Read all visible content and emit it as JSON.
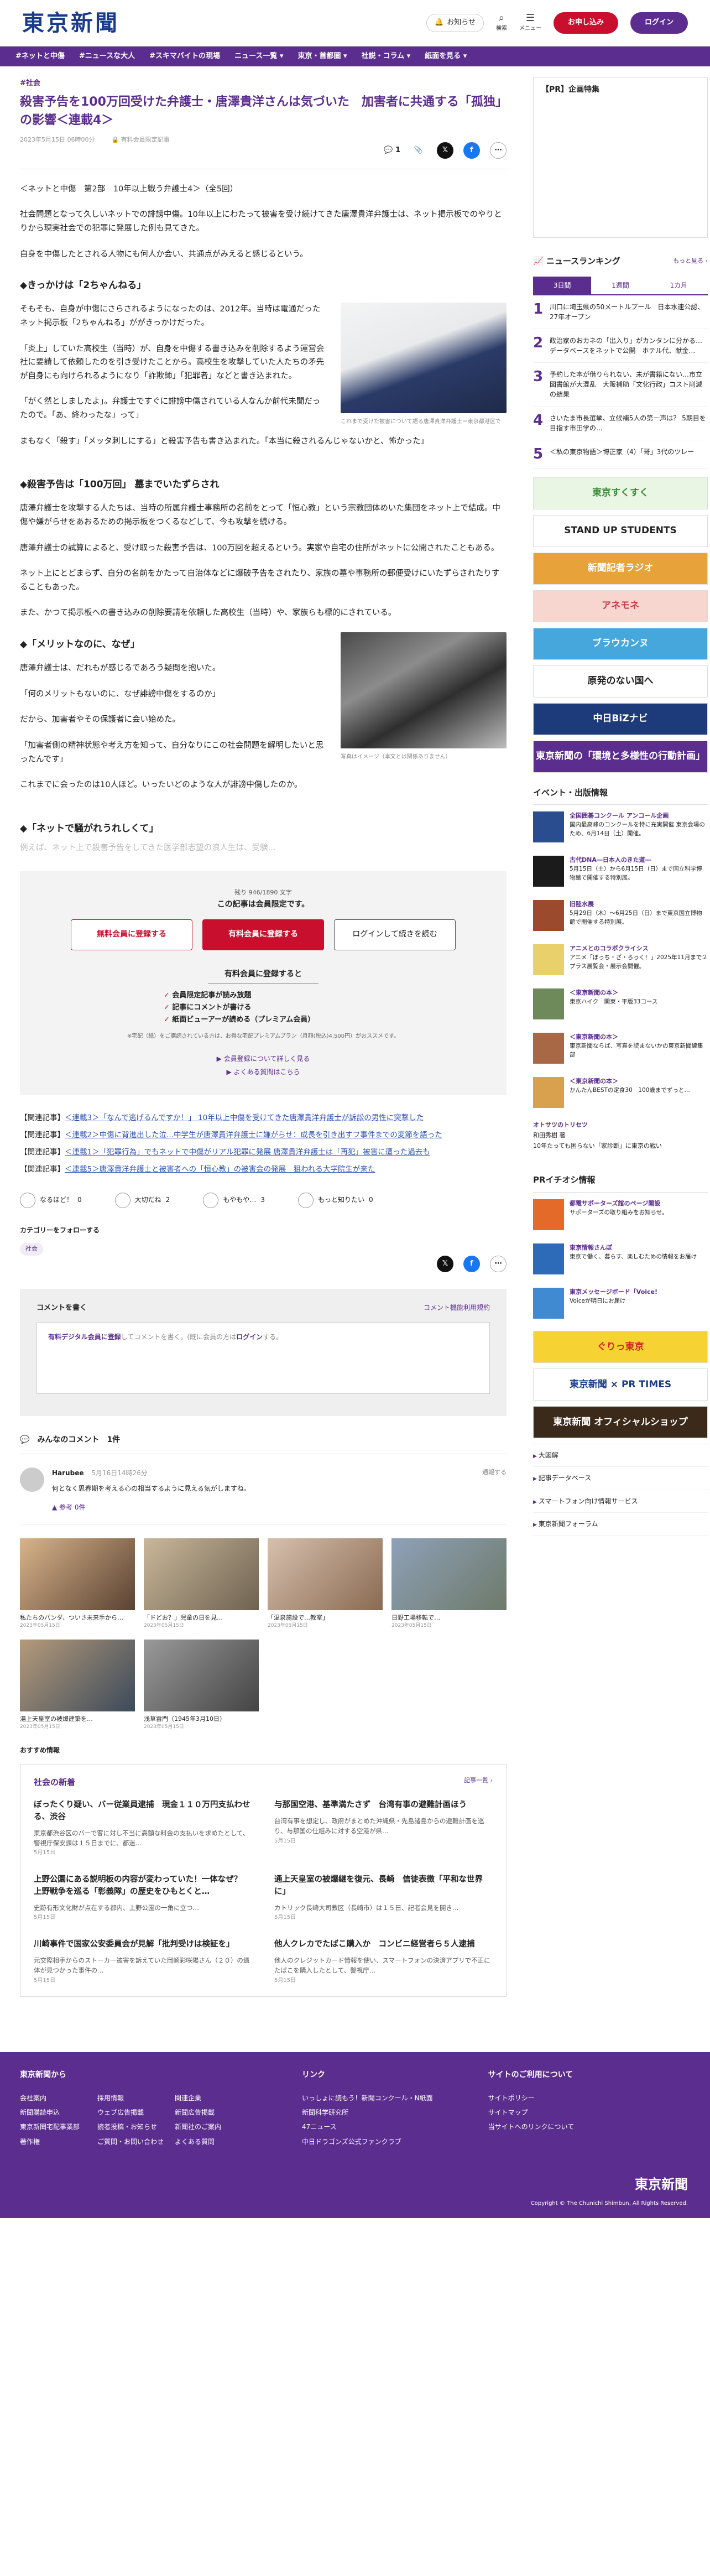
{
  "header": {
    "logo": "東京新聞",
    "notice": "お知らせ",
    "search": "検索",
    "menu": "メニュー",
    "apply": "お申し込み",
    "login": "ログイン"
  },
  "nav": [
    "#ネットと中傷",
    "#ニュースな大人",
    "#スキマバイトの現場",
    "ニュース一覧 ▾",
    "東京・首都圏 ▾",
    "社説・コラム ▾",
    "紙面を見る ▾"
  ],
  "article": {
    "category": "#社会",
    "title": "殺害予告を100万回受けた弁護士・唐澤貴洋さんは気づいた　加害者に共通する「孤独」の影響＜連載4＞",
    "date": "2023年5月15日 06時00分",
    "paid": "有料会員限定記事",
    "comment_count": "1",
    "series": "＜ネットと中傷　第2部　10年以上戦う弁護士4＞（全5回）",
    "p1": "社会問題となって久しいネットでの誹謗中傷。10年以上にわたって被害を受け続けてきた唐澤貴洋弁護士は、ネット掲示板でのやりとりから現実社会での犯罪に発展した例も見てきた。",
    "p2": "自身を中傷したとされる人物にも何人か会い、共通点がみえると感じるという。",
    "h1": "◆きっかけは「2ちゃんねる」",
    "p3": "そもそも、自身が中傷にさらされるようになったのは、2012年。当時は電通だったネット掲示板「2ちゃんねる」ががきっかけだった。",
    "p4": "「炎上」していた高校生（当時）が、自身を中傷する書き込みを削除するよう運営会社に要請して依頼したのを引き受けたことから。高校生を攻撃していた人たちの矛先が自身にも向けられるようになり「詐欺師」「犯罪者」などと書き込まれた。",
    "p5": "「がく然としましたよ」。弁護士ですぐに誹謗中傷されている人なんか前代未聞だったので。「あ、終わったな」って」",
    "p6": "まもなく「殺す」「メッタ刺しにする」と殺害予告も書き込まれた。「本当に殺されるんじゃないかと、怖かった」",
    "img1_caption": "これまで受けた被害について語る唐澤貴洋弁護士＝東京都港区で",
    "h2": "◆殺害予告は「100万回」 墓までいたずらされ",
    "p7": "唐澤弁護士を攻撃する人たちは、当時の所属弁護士事務所の名前をとって「恒心教」という宗教団体めいた集団をネット上で結成。中傷や嫌がらせをあおるための掲示板をつくるなどして、今も攻撃を続ける。",
    "p8": "唐澤弁護士の試算によると、受け取った殺害予告は、100万回を超えるという。実家や自宅の住所がネットに公開されたこともある。",
    "p9": "ネット上にとどまらず、自分の名前をかたって自治体などに爆破予告をされたり、家族の墓や事務所の郵便受けにいたずらされたりすることもあった。",
    "p10": "また、かつて掲示板への書き込みの削除要請を依頼した高校生（当時）や、家族らも標的にされている。",
    "h3": "◆「メリットなのに、なぜ」",
    "p11": "唐澤弁護士は、だれもが感じるであろう疑問を抱いた。",
    "p12": "「何のメリットもないのに、なぜ誹謗中傷をするのか」",
    "p13": "だから、加害者やその保護者に会い始めた。",
    "p14": "「加害者側の精神状態や考え方を知って、自分なりにこの社会問題を解明したいと思ったんです」",
    "p15": "これまでに会ったのは10人ほど。いったいどのような人が誹謗中傷したのか。",
    "img2_caption": "写真はイメージ（本文とは関係ありません）",
    "h4": "◆「ネットで騒がれうれしくて」",
    "fade": "例えば、ネット上で殺害予告をしてきた医学部志望の浪人生は、受験..."
  },
  "paywall": {
    "count": "残り 946/1890 文字",
    "head": "この記事は会員限定です。",
    "btn_free": "無料会員に登録する",
    "btn_paid": "有料会員に登録する",
    "btn_login": "ログインして続きを読む",
    "sub": "有料会員に登録すると",
    "b1": "会員限定記事が読み放題",
    "b2": "記事にコメントが書ける",
    "b3": "紙面ビューアーが読める（プレミアム会員）",
    "note": "※宅配（紙）をご購読されている方は、お得な宅配プレミアムプラン（月額(税込)4,500円）がおススメです。",
    "link1": "▶ 会員登録について詳しく見る",
    "link2": "▶ よくある質問はこちら"
  },
  "related": [
    {
      "pre": "【関連記事】",
      "text": "＜連載3＞「なんで逃げるんですか！」 10年以上中傷を受けてきた唐澤貴洋弁護士が訴訟の男性に突撃した"
    },
    {
      "pre": "【関連記事】",
      "text": "＜連載2＞中傷に背進出した泣...中学生が唐澤貴洋弁護士に嫌がらせ：成長を引き出すフ事件までの変節を語った"
    },
    {
      "pre": "【関連記事】",
      "text": "＜連載1＞「犯罪行為」でもネットで中傷がリアル犯罪に発展 唐澤貴洋弁護士は「再犯」被害に遭った過去も"
    },
    {
      "pre": "【関連記事】",
      "text": "＜連載5＞唐澤貴洋弁護士と被害者への「恒心教」の被害会の発展　狙われる大学院生が来た"
    }
  ],
  "reactions": [
    {
      "label": "なるほど！",
      "count": "0"
    },
    {
      "label": "大切だね",
      "count": "2"
    },
    {
      "label": "もやもや…",
      "count": "3"
    },
    {
      "label": "もっと知りたい",
      "count": "0"
    }
  ],
  "follow": {
    "label": "カテゴリーをフォローする",
    "tag": "社会"
  },
  "comment_form": {
    "title": "コメントを書く",
    "rules": "コメント機能利用規約",
    "placeholder_pre": "有料デジタル会員に登録",
    "placeholder_mid": "してコメントを書く。(既に会員の方は",
    "placeholder_login": "ログイン",
    "placeholder_post": "する。"
  },
  "comments": {
    "title": "みんなのコメント",
    "count": "1件",
    "items": [
      {
        "user": "Harubee",
        "date": "5月16日14時26分",
        "text": "何となく思春期を考える心の相当するように見える気がしますね。",
        "like": "▲ 参考  0件",
        "report": "通報する"
      }
    ]
  },
  "photos": [
    {
      "cap": "私たちのパンダ、ついさ未来手から…",
      "date": "2023年05月15日"
    },
    {
      "cap": "「ドどお？」児童の日を見…",
      "date": "2023年05月15日"
    },
    {
      "cap": "「温泉施設で…教室」",
      "date": "2023年05月15日"
    },
    {
      "cap": "日野工場移転で…",
      "date": "2023年05月15日"
    },
    {
      "cap": "湯上天皇室の被爆建築を…",
      "date": "2023年05月15日"
    },
    {
      "cap": "浅草雷門（1945年3月10日）",
      "date": "2023年05月15日"
    }
  ],
  "recos": {
    "head": "おすすめ情報",
    "title": "社会の新着",
    "more": "記事一覧 ›",
    "items": [
      {
        "title": "ぼったくり疑い、バー従業員逮捕　現金１１０万円支払わせる、渋谷",
        "desc": "東京都渋谷区のバーで客に対し不当に高額な料金の支払いを求めたとして、警視庁保安課は１５日までに、都迷...",
        "date": "5月15日"
      },
      {
        "title": "与那国空港、基準満たさず　台湾有事の避難計画ほう",
        "desc": "台湾有事を想定し、政府がまとめた沖縄県・先島諸島からの避難計画を巡り、与那国の仕組みに対する空港が県...",
        "date": "5月15日"
      },
      {
        "title": "上野公園にある説明板の内容が変わっていた！一体なぜ？ 上野戦争を巡る「彰義隊」の歴史をひもとくと…",
        "desc": "史跡有形文化財が点在する都内、上野公園の一角に立つ…",
        "date": "5月15日"
      },
      {
        "title": "通上天皇室の被爆継を復元、長崎　信徒表徴「平和な世界に」",
        "desc": "カトリック長崎大司教区（長崎市）は１５日、記者会見を開き…",
        "date": "5月15日"
      },
      {
        "title": "川崎事件で国家公安委員会が見解「批判受けは検証を」",
        "desc": "元交際相手からのストーカー被害を訴えていた岡崎彩咲陽さん（２０）の遺体が見つかった事件の…",
        "date": "5月15日"
      },
      {
        "title": "他人クレカでたばこ購入か　コンビニ経営者ら５人逮捕",
        "desc": "他人のクレジットカード情報を使い、スマートフォンの決済アプリで不正にたばこを購入したとして、警視庁…",
        "date": "5月15日"
      }
    ]
  },
  "side": {
    "pr": "【PR】企画特集",
    "rank_title": "ニュースランキング",
    "rank_more": "もっと見る ›",
    "rank_tabs": [
      "3日間",
      "1週間",
      "1カ月"
    ],
    "ranks": [
      {
        "n": "1",
        "t": "川口に埼玉県の50メートルプール　日本水連公認、27年オープン"
      },
      {
        "n": "2",
        "t": "政治家のおカネの「出入り」がカンタンに分かる…データベースをネットで公開　ホテル代、献金…"
      },
      {
        "n": "3",
        "t": "予約した本が借りられない、未が書籍にない…市立図書館が大混乱　大阪補助「文化行政」コスト削減の結果"
      },
      {
        "n": "4",
        "t": "さいたま市長選挙、立候補5人の第一声は？ 5期目を目指す市田学の…"
      },
      {
        "n": "5",
        "t": "＜私の東京物語＞博正家（4）「哥」3代のツレー"
      }
    ],
    "banners": [
      {
        "t": "東京すくすく",
        "bg": "#e9f6e3",
        "c": "#3a8a3a"
      },
      {
        "t": "STAND UP STUDENTS",
        "bg": "#fff",
        "c": "#222"
      },
      {
        "t": "新聞記者ラジオ",
        "bg": "#e7a33a",
        "c": "#fff"
      },
      {
        "t": "アネモネ",
        "bg": "#f8d6d0",
        "c": "#c0404a"
      },
      {
        "t": "ブラウカンヌ",
        "bg": "#45a7dc",
        "c": "#fff"
      },
      {
        "t": "原発のない国へ",
        "bg": "#fff",
        "c": "#222"
      },
      {
        "t": "中日BiZナビ",
        "bg": "#1d3b7a",
        "c": "#fff"
      },
      {
        "t": "東京新聞の「環境と多様性の行動計画」",
        "bg": "#5b2d8e",
        "c": "#fff"
      }
    ],
    "evt_title": "イベント・出版情報",
    "events": [
      {
        "t": "全国囲碁コンクール アンコール企画",
        "d": "国内最高峰のコンクールを特に充実開催 東京会場のため、6月14日（土）開催。",
        "color": "#2a4d8f"
      },
      {
        "t": "古代DNA―日本人のきた道―",
        "d": "5月15日（土）から6月15日（日）まで国立科学博物館で開催する特別展。",
        "color": "#1b1b1b"
      },
      {
        "t": "旧陸水展",
        "d": "5月29日（木）～6月25日（日）まで東京国立博物館で開催する特別展。",
        "color": "#9c4a2e"
      },
      {
        "t": "アニメとのコラボクライシス",
        "d": "アニメ「ぼっち・ざ・ろっく！」2025年11月まで２プラス展覧会・展示会開催。",
        "color": "#e9d06a"
      },
      {
        "t": "＜東京新聞の本＞",
        "d": "東京ハイク　関東・平版33コース",
        "color": "#6f8a5a"
      },
      {
        "t": "＜東京新聞の本＞",
        "d": "東京新聞ならば、写真を読まないかの東京新聞編集部",
        "color": "#a86845"
      },
      {
        "t": "＜東京新聞の本＞",
        "d": "かんたんBESTの定食30　100歳までずっと…",
        "color": "#d9a14e"
      }
    ],
    "kotsu_title": "オトサツのトリセツ",
    "kotsu_sub": "和田秀樹 著",
    "kotsu_text": "10年たっても困らない「家診断」に東京の戦い",
    "pr_title": "PRイチオシ情報",
    "prs": [
      {
        "t": "都電サポーターズ館のページ開設",
        "d": "サポーターズの取り組みをお知らせ。",
        "color": "#e46a2a"
      },
      {
        "t": "東京情報さんぽ",
        "d": "東京で働く、暮らす、楽しむための情報をお届け",
        "color": "#2d6bb8"
      },
      {
        "t": "東京メッセージボード「Voice!",
        "d": "Voiceが明日にお届け",
        "color": "#3f8ad0"
      }
    ],
    "banners2": [
      {
        "t": "ぐりっ東京",
        "bg": "#f6d233",
        "c": "#d6232b"
      },
      {
        "t": "東京新聞 × PR TIMES",
        "bg": "#fff",
        "c": "#1a3a8a"
      },
      {
        "t": "東京新聞 オフィシャルショップ",
        "bg": "#3b2a1a",
        "c": "#fff"
      }
    ],
    "links": [
      "大図解",
      "記事データベース",
      "スマートフォン向け情報サービス",
      "東京新聞フォーラム"
    ]
  },
  "footer": {
    "col1_title": "東京新聞から",
    "col1": [
      "会社案内",
      "採用情報",
      "関連企業",
      "新聞購読申込",
      "ウェブ広告掲載",
      "新聞広告掲載",
      "東京新聞宅配事業部",
      "読者投稿・お知らせ",
      "新聞社のご案内",
      "著作権",
      "ご質問・お問い合わせ",
      "よくある質問"
    ],
    "col2_title": "リンク",
    "col2": [
      "いっしょに読もう！新聞コンクール・N紙面",
      "新聞科学研究所",
      "47ニュース",
      "中日ドラゴンズ公式ファンクラブ"
    ],
    "col3_title": "サイトのご利用について",
    "col3": [
      "サイトポリシー",
      "サイトマップ",
      "当サイトへのリンクについて"
    ],
    "logo": "東京新聞",
    "copy": "Copyright © The Chunichi Shimbun, All Rights Reserved."
  }
}
